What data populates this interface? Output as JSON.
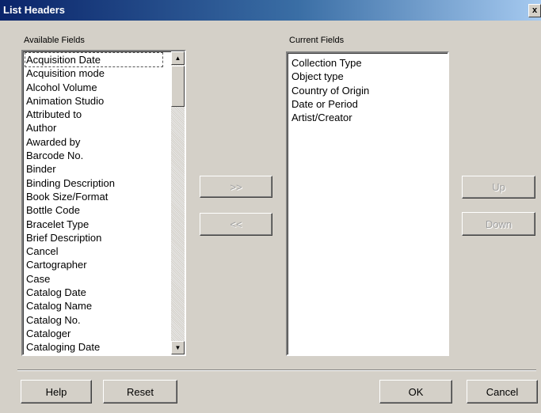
{
  "window": {
    "title": "List Headers",
    "close_label": "x"
  },
  "available": {
    "label": "Available Fields",
    "items": [
      "Acquisition Date",
      "Acquisition mode",
      "Alcohol Volume",
      "Animation Studio",
      "Attributed to",
      "Author",
      "Awarded by",
      "Barcode No.",
      "Binder",
      "Binding Description",
      "Book Size/Format",
      "Bottle Code",
      "Bracelet Type",
      "Brief Description",
      "Cancel",
      "Cartographer",
      "Case",
      "Catalog Date",
      "Catalog Name",
      "Catalog No.",
      "Cataloger",
      "Cataloging Date"
    ],
    "selected_index": 0
  },
  "current": {
    "label": "Current Fields",
    "items": [
      "Collection Type",
      "Object type",
      "Country of Origin",
      "Date or Period",
      "Artist/Creator"
    ]
  },
  "buttons": {
    "add": ">>",
    "remove": "<<",
    "up": "Up",
    "down": "Down",
    "help": "Help",
    "reset": "Reset",
    "ok": "OK",
    "cancel": "Cancel"
  }
}
